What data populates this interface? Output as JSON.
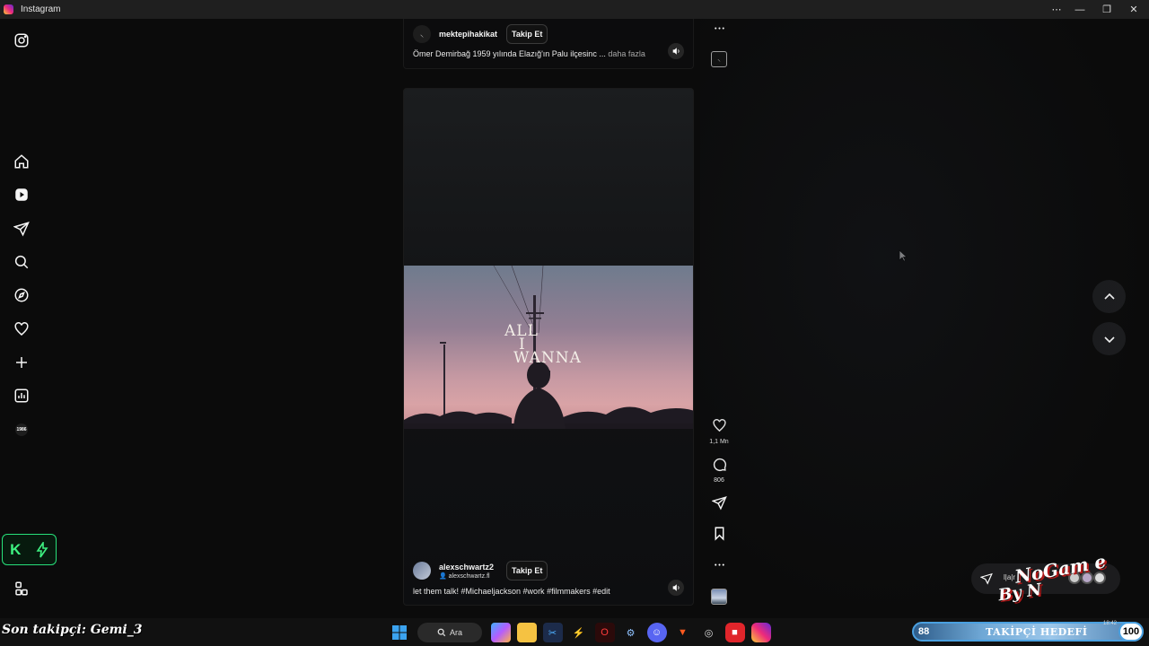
{
  "window": {
    "title": "Instagram",
    "controls": [
      "⋯",
      "—",
      "❐",
      "✕"
    ]
  },
  "sidebar": {
    "items": [
      {
        "name": "instagram-logo-icon"
      },
      {
        "name": "home-icon"
      },
      {
        "name": "reels-icon"
      },
      {
        "name": "messages-icon"
      },
      {
        "name": "search-icon"
      },
      {
        "name": "explore-icon"
      },
      {
        "name": "notifications-icon"
      },
      {
        "name": "create-icon"
      },
      {
        "name": "dashboard-icon"
      },
      {
        "name": "profile-icon",
        "label": "1986"
      },
      {
        "name": "more-icon"
      }
    ],
    "k_badge": {
      "letter": "K",
      "icon": "bolt-icon"
    }
  },
  "reel_top": {
    "username": "mektepihakikat",
    "follow_label": "Takip Et",
    "caption": "Ömer Demirbağ 1959 yılında Elazığ'ın Palu ilçesinc ...",
    "more_label": "daha fazla"
  },
  "reel_main": {
    "overlay_text": [
      "ALL",
      "I",
      "WANNA"
    ],
    "username": "alexschwartz2",
    "audio_label": "alexschwartz.fl",
    "follow_label": "Takip Et",
    "caption": "let them talk! #Michaeljackson #work #filmmakers #edit"
  },
  "actions": {
    "likes": "1,1 Mn",
    "comments": "806"
  },
  "overlay": {
    "brand_top": "NoGam e",
    "brand_bottom": "By N",
    "pill_text": "l|a|r"
  },
  "bottom": {
    "last_follower": "Son takipçi: Gemi_3",
    "search_label": "Ara",
    "goal": {
      "current": "88",
      "label": "TAKİPÇİ HEDEFİ",
      "target": "100",
      "time": "18:42"
    }
  },
  "colors": {
    "accent_green": "#27e07a",
    "goal_blue": "#4aa0e0"
  }
}
